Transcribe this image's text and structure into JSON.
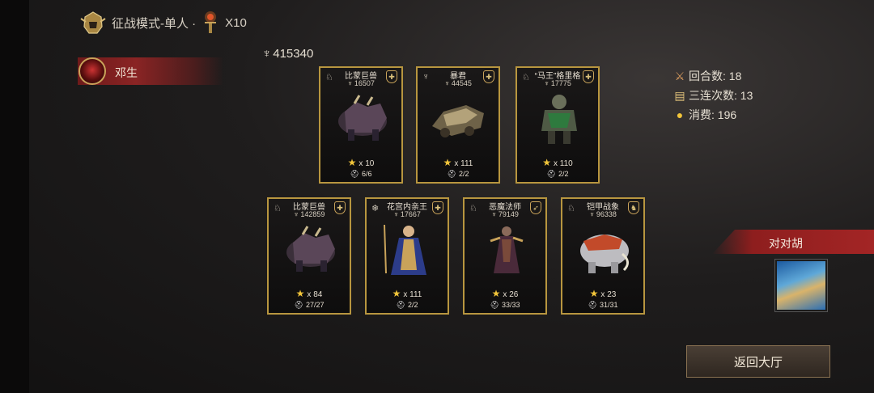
{
  "header": {
    "mode_label": "征战模式-单人 ·",
    "multiplier": "X10"
  },
  "player": {
    "name": "邓生"
  },
  "total_power": "415340",
  "cards_top": [
    {
      "name": "比蒙巨兽",
      "power": "16507",
      "stars": "x 10",
      "count": "6/6",
      "art": "behemoth"
    },
    {
      "name": "暴君",
      "power": "44545",
      "stars": "x 111",
      "count": "2/2",
      "art": "machine"
    },
    {
      "name": "“马王”格里格",
      "power": "17775",
      "stars": "x 110",
      "count": "2/2",
      "art": "knight"
    }
  ],
  "cards_bottom": [
    {
      "name": "比蒙巨兽",
      "power": "142859",
      "stars": "x 84",
      "count": "27/27",
      "art": "behemoth"
    },
    {
      "name": "花宫内亲王",
      "power": "17667",
      "stars": "x 111",
      "count": "2/2",
      "art": "priestess"
    },
    {
      "name": "恶魔法师",
      "power": "79149",
      "stars": "x 26",
      "count": "33/33",
      "art": "demon"
    },
    {
      "name": "铠甲战象",
      "power": "96338",
      "stars": "x 23",
      "count": "31/31",
      "art": "mammoth"
    }
  ],
  "stats": {
    "rounds": "回合数: 18",
    "triple": "三连次数: 13",
    "cost": "消费: 196"
  },
  "opponent": {
    "name": "对对胡"
  },
  "buttons": {
    "back": "返回大厅"
  },
  "colors": {
    "gold_border": "#b8963f",
    "banner_red": "#8e1e1e",
    "star": "#f2c53a"
  }
}
